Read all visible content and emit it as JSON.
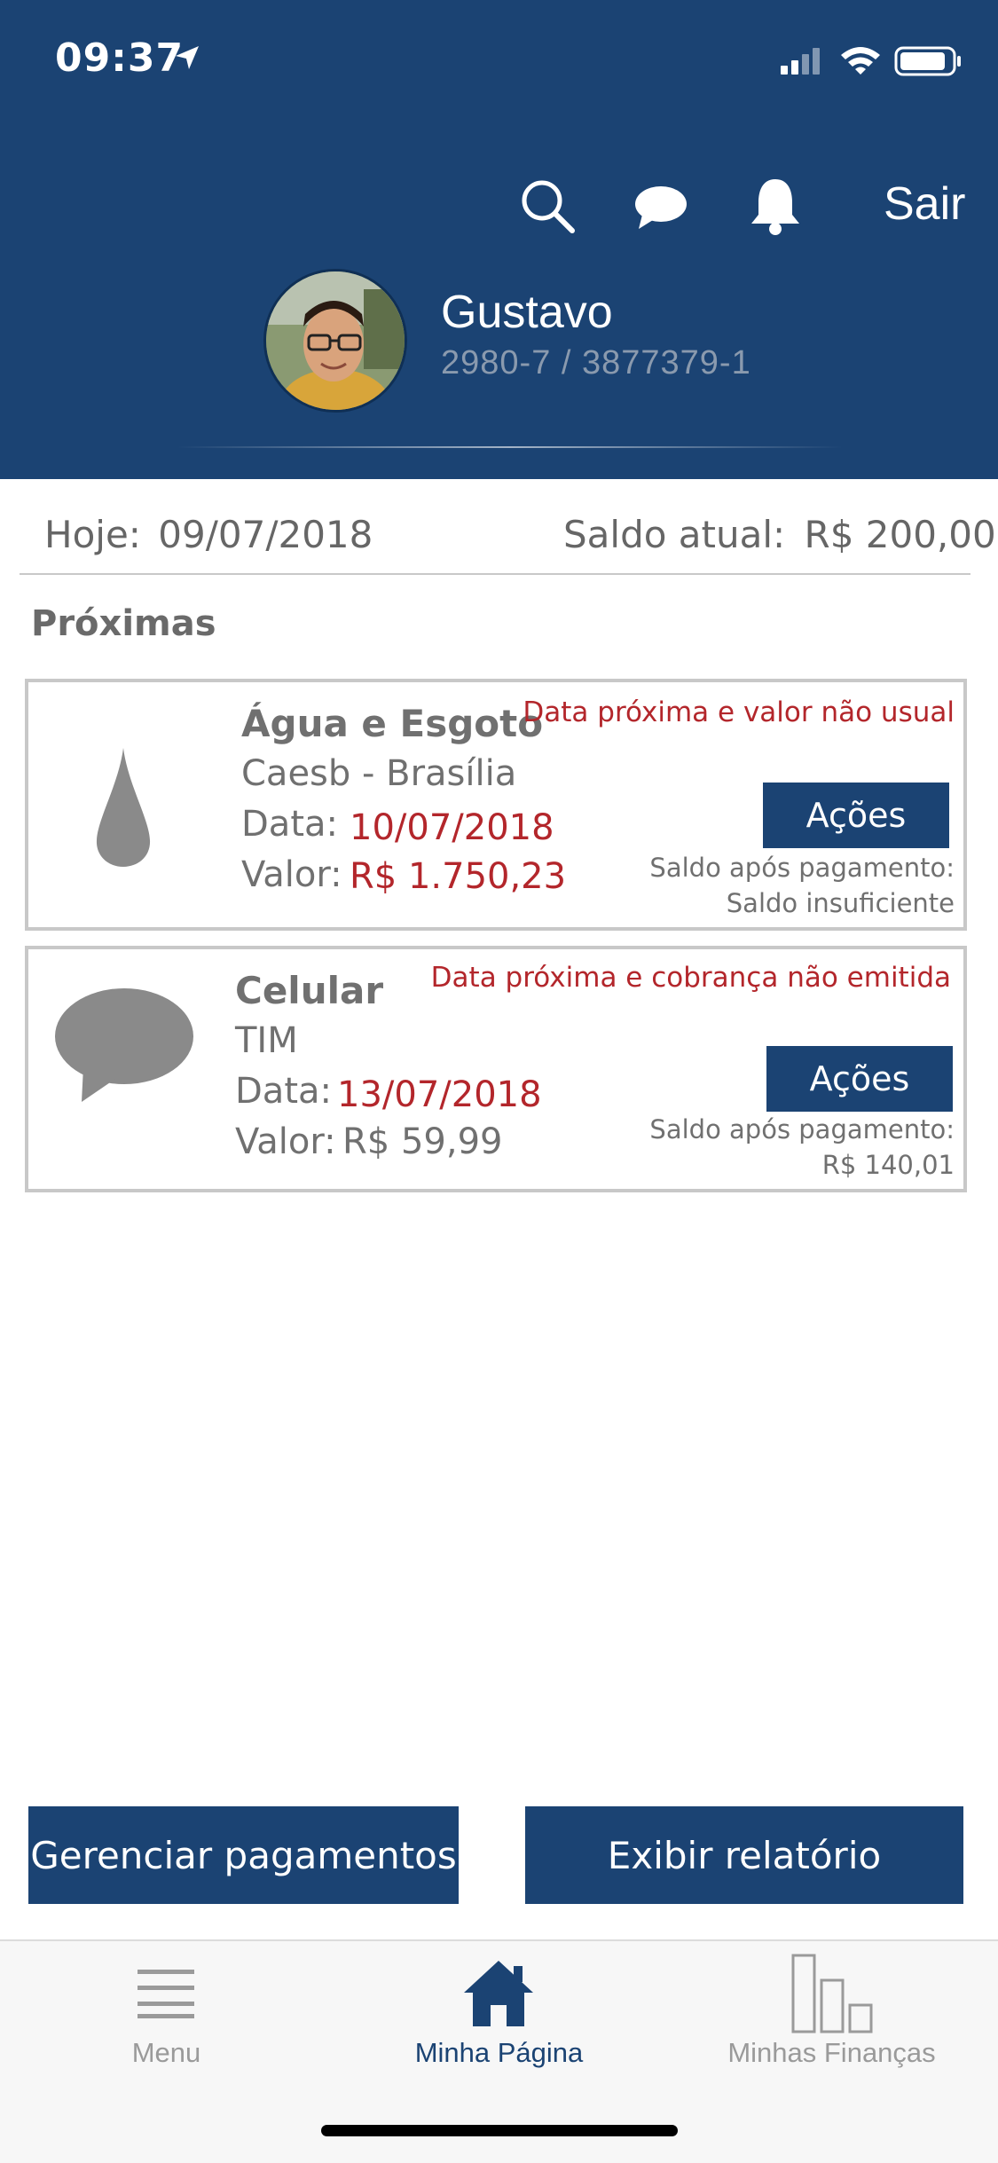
{
  "status_bar": {
    "time": "09:37"
  },
  "header": {
    "sair_label": "Sair",
    "user_name": "Gustavo",
    "user_account": "2980-7 / 3877379-1"
  },
  "info": {
    "hoje_label": "Hoje:",
    "hoje_date": "09/07/2018",
    "saldo_label": "Saldo atual:",
    "saldo_value": "R$ 200,00"
  },
  "section_title": "Próximas",
  "bills": [
    {
      "icon": "water-drop-icon",
      "title": "Água e Esgoto",
      "provider": "Caesb - Brasília",
      "data_label": "Data:",
      "data_value": "10/07/2018",
      "valor_label": "Valor:",
      "valor_value": "R$ 1.750,23",
      "warning": "Data próxima e  valor não usual",
      "action_label": "Ações",
      "saldo_apos_label": "Saldo após pagamento:",
      "saldo_apos_value": "Saldo insuficiente"
    },
    {
      "icon": "speech-bubble-icon",
      "title": "Celular",
      "provider": "TIM",
      "data_label": "Data:",
      "data_value": "13/07/2018",
      "valor_label": "Valor:",
      "valor_value": "R$ 59,99",
      "warning": "Data próxima e cobrança não emitida",
      "action_label": "Ações",
      "saldo_apos_label": "Saldo após pagamento:",
      "saldo_apos_value": "R$ 140,01"
    }
  ],
  "buttons": {
    "gerenciar": "Gerenciar pagamentos",
    "relatorio": "Exibir relatório"
  },
  "tabs": [
    {
      "label": "Menu",
      "icon": "menu-icon",
      "active": false
    },
    {
      "label": "Minha Página",
      "icon": "home-icon",
      "active": true
    },
    {
      "label": "Minhas Finanças",
      "icon": "bar-chart-icon",
      "active": false
    }
  ],
  "colors": {
    "brand": "#1b4373",
    "warning": "#b3262b",
    "inactive_tab": "#9a9a9a"
  }
}
